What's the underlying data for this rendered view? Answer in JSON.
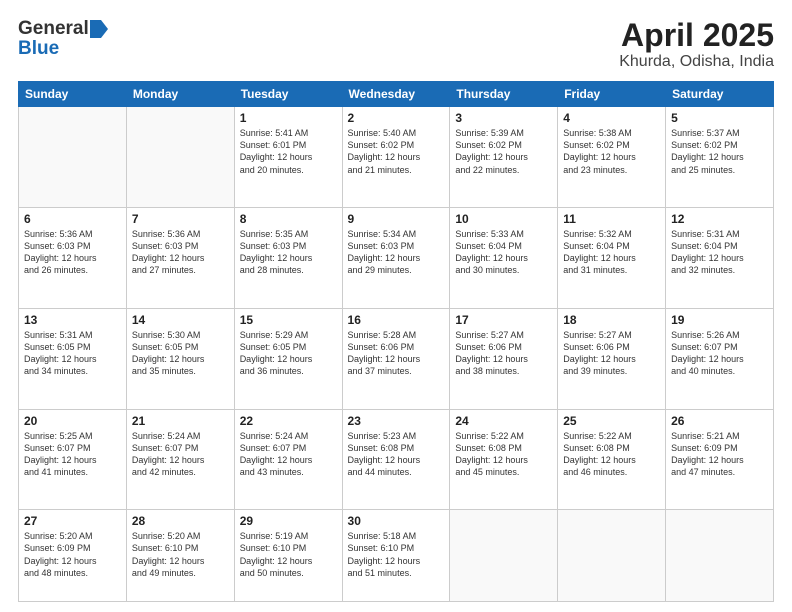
{
  "header": {
    "logo_general": "General",
    "logo_blue": "Blue",
    "title": "April 2025",
    "location": "Khurda, Odisha, India"
  },
  "days_of_week": [
    "Sunday",
    "Monday",
    "Tuesday",
    "Wednesday",
    "Thursday",
    "Friday",
    "Saturday"
  ],
  "weeks": [
    [
      {
        "day": "",
        "info": ""
      },
      {
        "day": "",
        "info": ""
      },
      {
        "day": "1",
        "info": "Sunrise: 5:41 AM\nSunset: 6:01 PM\nDaylight: 12 hours\nand 20 minutes."
      },
      {
        "day": "2",
        "info": "Sunrise: 5:40 AM\nSunset: 6:02 PM\nDaylight: 12 hours\nand 21 minutes."
      },
      {
        "day": "3",
        "info": "Sunrise: 5:39 AM\nSunset: 6:02 PM\nDaylight: 12 hours\nand 22 minutes."
      },
      {
        "day": "4",
        "info": "Sunrise: 5:38 AM\nSunset: 6:02 PM\nDaylight: 12 hours\nand 23 minutes."
      },
      {
        "day": "5",
        "info": "Sunrise: 5:37 AM\nSunset: 6:02 PM\nDaylight: 12 hours\nand 25 minutes."
      }
    ],
    [
      {
        "day": "6",
        "info": "Sunrise: 5:36 AM\nSunset: 6:03 PM\nDaylight: 12 hours\nand 26 minutes."
      },
      {
        "day": "7",
        "info": "Sunrise: 5:36 AM\nSunset: 6:03 PM\nDaylight: 12 hours\nand 27 minutes."
      },
      {
        "day": "8",
        "info": "Sunrise: 5:35 AM\nSunset: 6:03 PM\nDaylight: 12 hours\nand 28 minutes."
      },
      {
        "day": "9",
        "info": "Sunrise: 5:34 AM\nSunset: 6:03 PM\nDaylight: 12 hours\nand 29 minutes."
      },
      {
        "day": "10",
        "info": "Sunrise: 5:33 AM\nSunset: 6:04 PM\nDaylight: 12 hours\nand 30 minutes."
      },
      {
        "day": "11",
        "info": "Sunrise: 5:32 AM\nSunset: 6:04 PM\nDaylight: 12 hours\nand 31 minutes."
      },
      {
        "day": "12",
        "info": "Sunrise: 5:31 AM\nSunset: 6:04 PM\nDaylight: 12 hours\nand 32 minutes."
      }
    ],
    [
      {
        "day": "13",
        "info": "Sunrise: 5:31 AM\nSunset: 6:05 PM\nDaylight: 12 hours\nand 34 minutes."
      },
      {
        "day": "14",
        "info": "Sunrise: 5:30 AM\nSunset: 6:05 PM\nDaylight: 12 hours\nand 35 minutes."
      },
      {
        "day": "15",
        "info": "Sunrise: 5:29 AM\nSunset: 6:05 PM\nDaylight: 12 hours\nand 36 minutes."
      },
      {
        "day": "16",
        "info": "Sunrise: 5:28 AM\nSunset: 6:06 PM\nDaylight: 12 hours\nand 37 minutes."
      },
      {
        "day": "17",
        "info": "Sunrise: 5:27 AM\nSunset: 6:06 PM\nDaylight: 12 hours\nand 38 minutes."
      },
      {
        "day": "18",
        "info": "Sunrise: 5:27 AM\nSunset: 6:06 PM\nDaylight: 12 hours\nand 39 minutes."
      },
      {
        "day": "19",
        "info": "Sunrise: 5:26 AM\nSunset: 6:07 PM\nDaylight: 12 hours\nand 40 minutes."
      }
    ],
    [
      {
        "day": "20",
        "info": "Sunrise: 5:25 AM\nSunset: 6:07 PM\nDaylight: 12 hours\nand 41 minutes."
      },
      {
        "day": "21",
        "info": "Sunrise: 5:24 AM\nSunset: 6:07 PM\nDaylight: 12 hours\nand 42 minutes."
      },
      {
        "day": "22",
        "info": "Sunrise: 5:24 AM\nSunset: 6:07 PM\nDaylight: 12 hours\nand 43 minutes."
      },
      {
        "day": "23",
        "info": "Sunrise: 5:23 AM\nSunset: 6:08 PM\nDaylight: 12 hours\nand 44 minutes."
      },
      {
        "day": "24",
        "info": "Sunrise: 5:22 AM\nSunset: 6:08 PM\nDaylight: 12 hours\nand 45 minutes."
      },
      {
        "day": "25",
        "info": "Sunrise: 5:22 AM\nSunset: 6:08 PM\nDaylight: 12 hours\nand 46 minutes."
      },
      {
        "day": "26",
        "info": "Sunrise: 5:21 AM\nSunset: 6:09 PM\nDaylight: 12 hours\nand 47 minutes."
      }
    ],
    [
      {
        "day": "27",
        "info": "Sunrise: 5:20 AM\nSunset: 6:09 PM\nDaylight: 12 hours\nand 48 minutes."
      },
      {
        "day": "28",
        "info": "Sunrise: 5:20 AM\nSunset: 6:10 PM\nDaylight: 12 hours\nand 49 minutes."
      },
      {
        "day": "29",
        "info": "Sunrise: 5:19 AM\nSunset: 6:10 PM\nDaylight: 12 hours\nand 50 minutes."
      },
      {
        "day": "30",
        "info": "Sunrise: 5:18 AM\nSunset: 6:10 PM\nDaylight: 12 hours\nand 51 minutes."
      },
      {
        "day": "",
        "info": ""
      },
      {
        "day": "",
        "info": ""
      },
      {
        "day": "",
        "info": ""
      }
    ]
  ]
}
